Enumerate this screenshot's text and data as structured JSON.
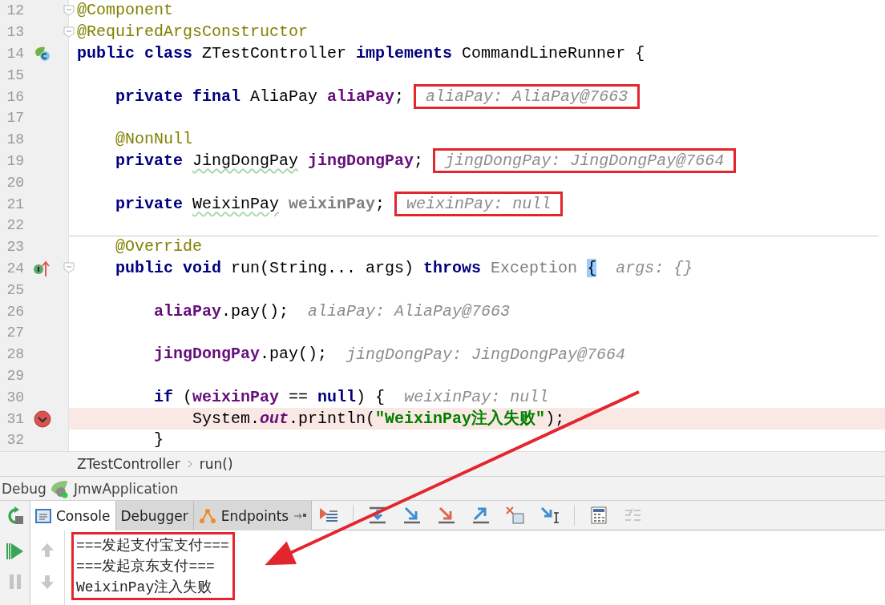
{
  "editor": {
    "lines": [
      {
        "number": "12",
        "fold": true,
        "current": false,
        "tokens": [
          {
            "kind": "annotation",
            "text": "@Component"
          }
        ]
      },
      {
        "number": "13",
        "fold": true,
        "current": false,
        "tokens": [
          {
            "kind": "annotation",
            "text": "@RequiredArgsConstructor"
          }
        ]
      },
      {
        "number": "14",
        "fold": false,
        "current": false,
        "gutter_marker": {
          "kind": "bean"
        },
        "tokens": [
          {
            "kind": "keyword",
            "text": "public class "
          },
          {
            "kind": "plain",
            "text": "ZTestController "
          },
          {
            "kind": "keyword",
            "text": "implements "
          },
          {
            "kind": "plain",
            "text": "CommandLineRunner {"
          }
        ]
      },
      {
        "number": "15",
        "fold": false,
        "current": false
      },
      {
        "number": "16",
        "fold": false,
        "current": false,
        "tokens": [
          {
            "kind": "keyword",
            "text": "    private final "
          },
          {
            "kind": "plain",
            "text": "AliaPay "
          },
          {
            "kind": "field",
            "text": "aliaPay"
          },
          {
            "kind": "plain",
            "text": ";"
          }
        ],
        "hint": {
          "text": "aliaPay: AliaPay@7663",
          "highlighted": true
        }
      },
      {
        "number": "17",
        "fold": false,
        "current": false
      },
      {
        "number": "18",
        "fold": false,
        "current": false,
        "tokens": [
          {
            "kind": "annotation",
            "text": "    @NonNull"
          }
        ]
      },
      {
        "number": "19",
        "fold": false,
        "current": false,
        "tokens": [
          {
            "kind": "keyword",
            "text": "    private "
          },
          {
            "kind": "warned_type",
            "text": "JingDongPay"
          },
          {
            "kind": "field",
            "text": " jingDongPay"
          },
          {
            "kind": "plain",
            "text": ";"
          }
        ],
        "hint": {
          "text": "jingDongPay: JingDongPay@7664",
          "highlighted": true
        }
      },
      {
        "number": "20",
        "fold": false,
        "current": false
      },
      {
        "number": "21",
        "fold": false,
        "current": false,
        "tokens": [
          {
            "kind": "keyword",
            "text": "    private "
          },
          {
            "kind": "warned_type",
            "text": "WeixinPay"
          },
          {
            "kind": "unused_field",
            "text": " weixinPay"
          },
          {
            "kind": "plain",
            "text": ";"
          }
        ],
        "hint": {
          "text": "weixinPay: null",
          "highlighted": true
        }
      },
      {
        "number": "22",
        "fold": false,
        "current": false
      },
      {
        "number": "23",
        "fold": false,
        "current": false,
        "separator_above": true,
        "tokens": [
          {
            "kind": "annotation",
            "text": "    @Override"
          }
        ]
      },
      {
        "number": "24",
        "fold": true,
        "current": false,
        "gutter_marker": {
          "kind": "implements"
        },
        "tokens": [
          {
            "kind": "keyword",
            "text": "    public void "
          },
          {
            "kind": "plain",
            "text": "run(String... args) "
          },
          {
            "kind": "keyword",
            "text": "throws "
          },
          {
            "kind": "gray_type",
            "text": "Exception "
          },
          {
            "kind": "brace_match",
            "text": "{"
          }
        ],
        "hint": {
          "text": "args: {}",
          "highlighted": false
        }
      },
      {
        "number": "25",
        "fold": false,
        "current": false
      },
      {
        "number": "26",
        "fold": false,
        "current": false,
        "tokens": [
          {
            "kind": "field",
            "text": "        aliaPay"
          },
          {
            "kind": "plain",
            "text": ".pay();"
          }
        ],
        "hint": {
          "text": "aliaPay: AliaPay@7663",
          "highlighted": false
        }
      },
      {
        "number": "27",
        "fold": false,
        "current": false
      },
      {
        "number": "28",
        "fold": false,
        "current": false,
        "tokens": [
          {
            "kind": "field",
            "text": "        jingDongPay"
          },
          {
            "kind": "plain",
            "text": ".pay();"
          }
        ],
        "hint": {
          "text": "jingDongPay: JingDongPay@7664",
          "highlighted": false
        }
      },
      {
        "number": "29",
        "fold": false,
        "current": false
      },
      {
        "number": "30",
        "fold": false,
        "current": false,
        "tokens": [
          {
            "kind": "keyword",
            "text": "        if "
          },
          {
            "kind": "plain",
            "text": "("
          },
          {
            "kind": "field",
            "text": "weixinPay"
          },
          {
            "kind": "plain",
            "text": " == "
          },
          {
            "kind": "keyword",
            "text": "null"
          },
          {
            "kind": "plain",
            "text": ") {"
          }
        ],
        "hint": {
          "text": "weixinPay: null",
          "highlighted": false
        }
      },
      {
        "number": "31",
        "fold": false,
        "current": true,
        "gutter_marker": {
          "kind": "breakpoint"
        },
        "tokens": [
          {
            "kind": "plain",
            "text": "            System."
          },
          {
            "kind": "static_field",
            "text": "out"
          },
          {
            "kind": "plain",
            "text": ".println("
          },
          {
            "kind": "string",
            "text": "\"WeixinPay注入失败\""
          },
          {
            "kind": "plain",
            "text": ");"
          }
        ]
      },
      {
        "number": "32",
        "fold": false,
        "current": false,
        "tokens": [
          {
            "kind": "plain",
            "text": "        }"
          }
        ]
      }
    ]
  },
  "breadcrumb": {
    "items": [
      "ZTestController",
      "run()"
    ]
  },
  "debug": {
    "label": "Debug",
    "config": "JmwApplication",
    "tabs": [
      {
        "label": "Console",
        "selected": true,
        "kind": "console"
      },
      {
        "label": "Debugger",
        "selected": false,
        "kind": "plain"
      },
      {
        "label": "Endpoints",
        "selected": false,
        "kind": "endpoints"
      }
    ],
    "console": {
      "highlighted": true,
      "lines": [
        "===发起支付宝支付===",
        "===发起京东支付===",
        "WeixinPay注入失败"
      ]
    }
  }
}
